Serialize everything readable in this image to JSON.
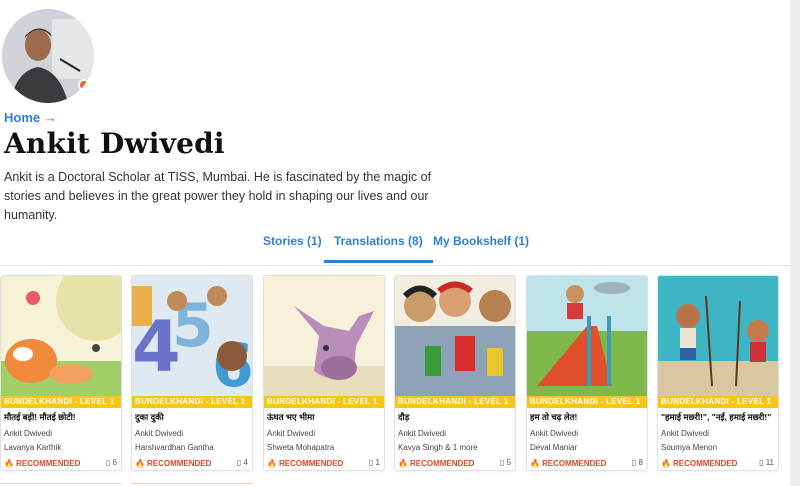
{
  "profile": {
    "breadcrumb": "Home →",
    "name": "Ankit Dwivedi",
    "bio": "Ankit is a Doctoral Scholar at TISS, Mumbai. He is fascinated by the magic of stories and believes in the great power they hold in shaping our lives and our humanity."
  },
  "tabs": [
    {
      "label": "Stories (1)"
    },
    {
      "label": "Translations (8)"
    },
    {
      "label": "My Bookshelf (1)"
    }
  ],
  "cards": [
    {
      "level": "BUNDELKHANDI - LEVEL 1",
      "title": "मौतई बड़ी! मौतई छोटी!",
      "author": "Ankit Dwivedi",
      "illustrator": "Lavanya Karthik",
      "recommended": "RECOMMENDED",
      "reads": "6"
    },
    {
      "level": "BUNDELKHANDI - LEVEL 1",
      "title": "दुका दुकी",
      "author": "Ankit Dwivedi",
      "illustrator": "Harshvardhan Gantha",
      "recommended": "RECOMMENDED",
      "reads": "4"
    },
    {
      "level": "BUNDELKHANDI - LEVEL 1",
      "title": "ऊंघत भए भीमा",
      "author": "Ankit Dwivedi",
      "illustrator": "Shweta Mohapatra",
      "recommended": "RECOMMENDED",
      "reads": "1"
    },
    {
      "level": "BUNDELKHANDI - LEVEL 1",
      "title": "दौड़",
      "author": "Ankit Dwivedi",
      "illustrator": "Kavya Singh & 1 more",
      "recommended": "RECOMMENDED",
      "reads": "5"
    },
    {
      "level": "BUNDELKHANDI - LEVEL 1",
      "title": "हम तो चढ़ लेत!",
      "author": "Ankit Dwivedi",
      "illustrator": "Deval Maniar",
      "recommended": "RECOMMENDED",
      "reads": "8"
    },
    {
      "level": "BUNDELKHANDI - LEVEL 1",
      "title": "\"हमाई मछरी!\", \"नईं, हमाई मछरी!\"",
      "author": "Ankit Dwivedi",
      "illustrator": "Soumya Menon",
      "recommended": "RECOMMENDED",
      "reads": "11"
    }
  ],
  "colors": {
    "accent": "#2f7fd3",
    "level_banner": "#f5c518",
    "recommended": "#d9482b"
  }
}
